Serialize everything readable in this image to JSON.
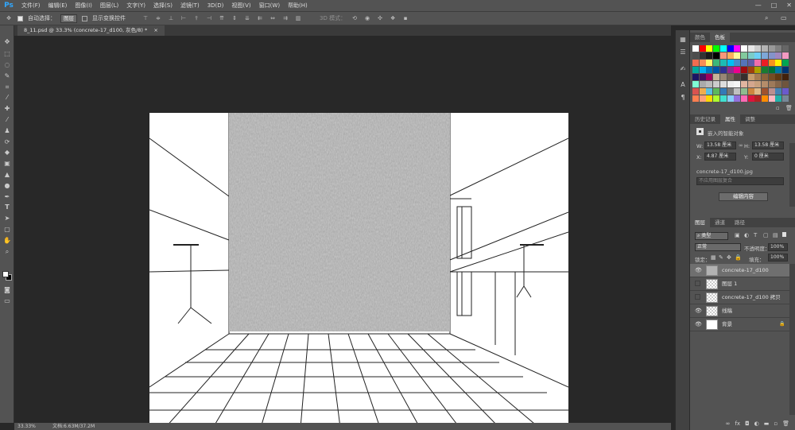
{
  "app": {
    "logo": "Ps"
  },
  "menu": [
    "文件(F)",
    "编辑(E)",
    "图像(I)",
    "图层(L)",
    "文字(Y)",
    "选择(S)",
    "滤镜(T)",
    "3D(D)",
    "视图(V)",
    "窗口(W)",
    "帮助(H)"
  ],
  "window_controls": {
    "min": "—",
    "max": "□",
    "close": "✕"
  },
  "options": {
    "auto_select_label": "自动选择：",
    "auto_select_target": "图层",
    "show_transform_label": "显示变换控件",
    "mode_3d_label": "3D 模式："
  },
  "document": {
    "tab_title": "8_11.psd @ 33.3% (concrete-17_d100, 灰色/8) *",
    "tab_close": "×"
  },
  "status": {
    "zoom": "33.33%",
    "doc_info": "文档:6.63M/37.2M"
  },
  "swatch_panel": {
    "tabs": [
      "颜色",
      "色板"
    ],
    "active": 1
  },
  "properties_panel": {
    "tabs": [
      "历史记录",
      "属性",
      "调整"
    ],
    "active": 1,
    "object_type": "嵌入的智能对象",
    "w_label": "W:",
    "w_value": "13.58 厘米",
    "h_label": "H:",
    "h_value": "13.58 厘米",
    "x_label": "X:",
    "x_value": "4.87 厘米",
    "y_label": "Y:",
    "y_value": "0 厘米",
    "filename": "concrete-17_d100.jpg",
    "comp_placeholder": "不应用图层复合",
    "edit_button": "编辑内容"
  },
  "layers_panel": {
    "tabs": [
      "图层",
      "通道",
      "路径"
    ],
    "active": 0,
    "filter_kind": "类型",
    "blend_mode": "正常",
    "opacity_label": "不透明度：",
    "opacity_value": "100%",
    "lock_label": "锁定：",
    "fill_label": "填充：",
    "fill_value": "100%",
    "layers": [
      {
        "name": "concrete-17_d100",
        "visible": true,
        "selected": true
      },
      {
        "name": "图层 1",
        "visible": false,
        "selected": false
      },
      {
        "name": "concrete-17_d100 拷贝",
        "visible": false,
        "selected": false
      },
      {
        "name": "线稿",
        "visible": true,
        "selected": false
      },
      {
        "name": "背景",
        "visible": true,
        "selected": false
      }
    ]
  },
  "icons": {
    "move": "move-icon",
    "marquee": "marquee-icon",
    "lasso": "lasso-icon",
    "quick-select": "quick-select-icon",
    "crop": "crop-icon",
    "eyedropper": "eyedropper-icon",
    "healing": "healing-brush-icon",
    "brush": "brush-icon",
    "stamp": "clone-stamp-icon",
    "history-brush": "history-brush-icon",
    "eraser": "eraser-icon",
    "gradient": "gradient-icon",
    "blur": "blur-icon",
    "dodge": "dodge-icon",
    "pen": "pen-icon",
    "type": "type-icon",
    "path-select": "path-select-icon",
    "shape": "shape-icon",
    "hand": "hand-icon",
    "zoom": "zoom-icon"
  }
}
